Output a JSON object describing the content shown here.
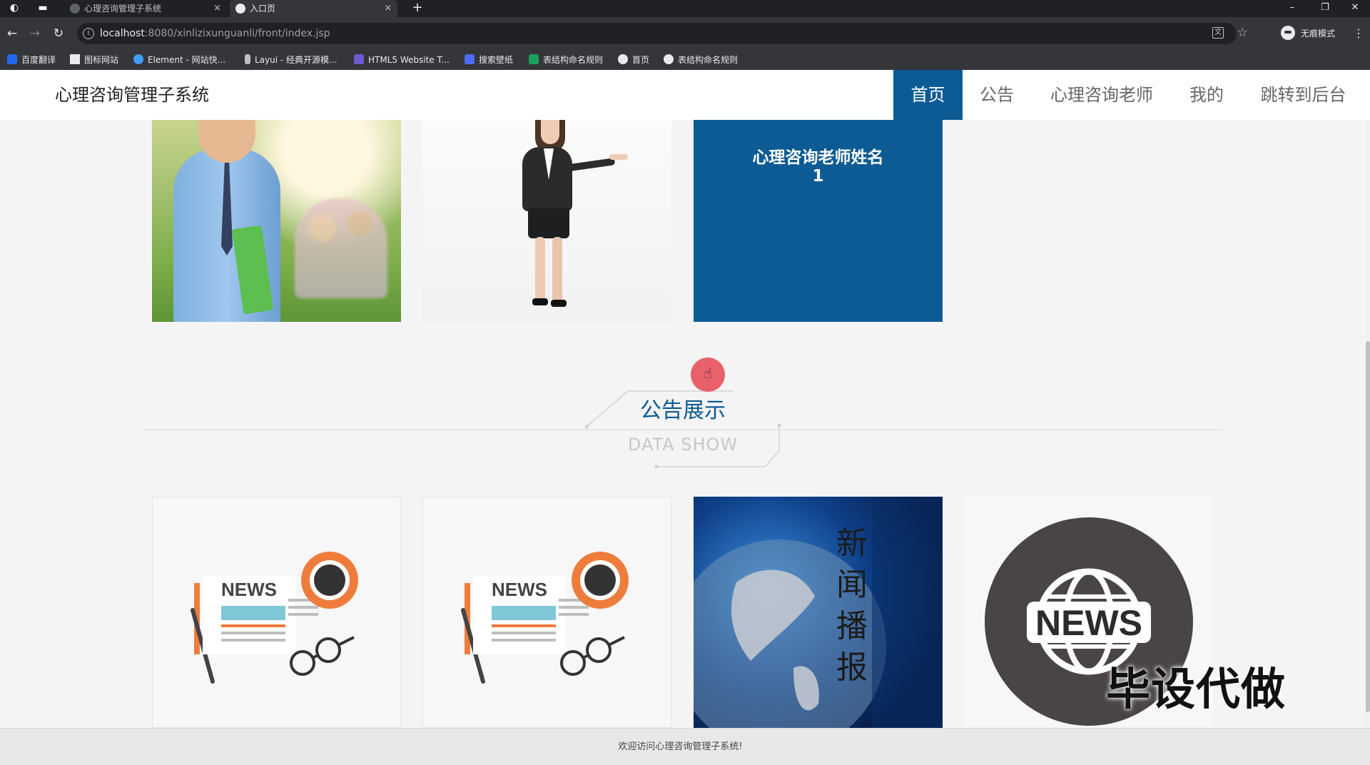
{
  "browser": {
    "tabs": [
      {
        "title": "心理咨询管理子系统",
        "close": "×"
      },
      {
        "title": "入口页",
        "close": "×"
      }
    ],
    "new_tab": "+",
    "window_controls": {
      "minimize": "–",
      "restore": "❐",
      "close": "✕"
    },
    "url_host": "localhost",
    "url_path": ":8080/xinlizixunguanli/front/index.jsp",
    "profile_label": "无痕模式",
    "bookmarks": [
      {
        "label": "百度翻译",
        "icon": "baidu-translate-icon",
        "color": "#2468f2"
      },
      {
        "label": "图标网站",
        "icon": "flag-icon",
        "color": "#e8eaed"
      },
      {
        "label": "Element - 网站快...",
        "icon": "element-icon",
        "color": "#409eff"
      },
      {
        "label": "Layui - 经典开源模...",
        "icon": "layui-icon",
        "color": "#bdc1c6"
      },
      {
        "label": "HTML5 Website T...",
        "icon": "html5-icon",
        "color": "#6f5cd3"
      },
      {
        "label": "搜索壁纸",
        "icon": "wallpaper-icon",
        "color": "#4a6cf7"
      },
      {
        "label": "表结构命名规则",
        "icon": "sheet-icon",
        "color": "#1aa15f"
      },
      {
        "label": "首页",
        "icon": "globe-icon",
        "color": "#e8eaed"
      },
      {
        "label": "表结构命名规则",
        "icon": "globe-icon",
        "color": "#e8eaed"
      }
    ]
  },
  "site": {
    "title": "心理咨询管理子系统",
    "nav": [
      "首页",
      "公告",
      "心理咨询老师",
      "我的",
      "跳转到后台"
    ],
    "active_nav": "首页",
    "accent_color": "#0d5b94"
  },
  "teachers": {
    "name_card": "心理咨询老师姓名\n1"
  },
  "section": {
    "title": "公告展示",
    "subtitle": "DATA SHOW"
  },
  "news_cards": {
    "newspaper_label": "NEWS",
    "globe_text": "新闻播报",
    "circle_label": "NEWS"
  },
  "watermark": "毕设代做",
  "footer": {
    "text": "欢迎访问心理咨询管理子系统!"
  }
}
